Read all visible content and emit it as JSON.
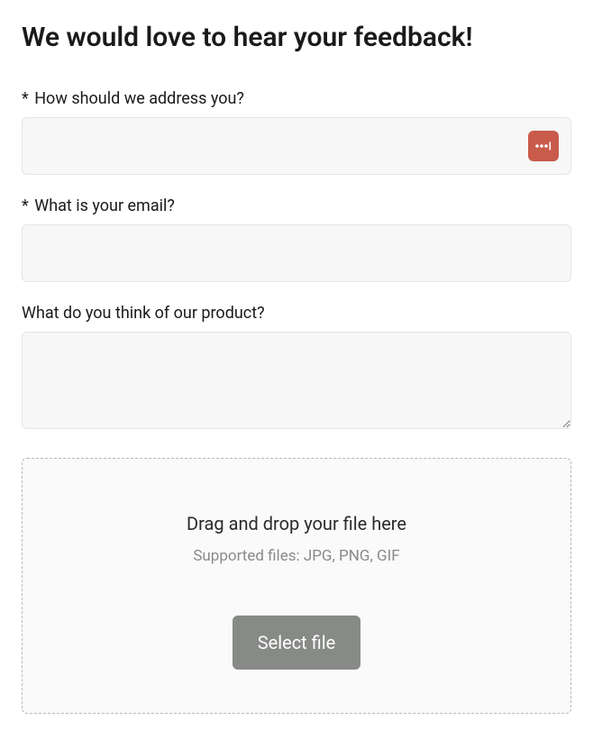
{
  "title": "We would love to hear your feedback!",
  "fields": {
    "name": {
      "label": "How should we address you?",
      "required_prefix": "* ",
      "value": ""
    },
    "email": {
      "label": "What is your email?",
      "required_prefix": "* ",
      "value": ""
    },
    "feedback": {
      "label": "What do you think of our product?",
      "value": ""
    }
  },
  "dropzone": {
    "title": "Drag and drop your file here",
    "hint": "Supported files: JPG, PNG, GIF",
    "button": "Select file"
  }
}
